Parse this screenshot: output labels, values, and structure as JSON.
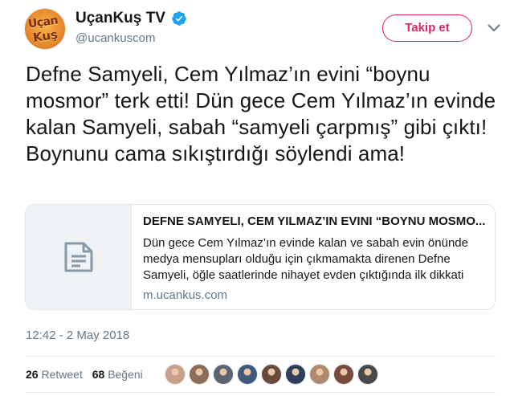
{
  "header": {
    "display_name": "UçanKuş TV",
    "handle": "@ucankuscom",
    "avatar_text_top": "Uçan",
    "avatar_text_bottom": "Kuş",
    "follow_label": "Takip et"
  },
  "tweet": {
    "text": "Defne Samyeli, Cem Yılmaz’ın evini “boynu mosmor” terk etti! Dün gece Cem Yılmaz’ın evinde kalan Samyeli, sabah “samyeli çarpmış” gibi çıktı! Boynunu cama sıkıştırdığı söylendi ama!",
    "timestamp": "12:42 - 2 May 2018"
  },
  "card": {
    "title": "DEFNE SAMYELI, CEM YILMAZ’IN EVINI “BOYNU MOSMO...",
    "description": "Dün gece Cem Yılmaz’ın evinde kalan ve sabah evin önünde medya mensupları olduğu için çıkmamakta direnen Defne Samyeli, öğle saatlerinde nihayet evden çıktığında ilk dikkati çe...",
    "domain": "m.ucankus.com",
    "icon": "document-icon"
  },
  "stats": {
    "retweets_count": "26",
    "retweets_label": "Retweet",
    "likes_count": "68",
    "likes_label": "Beğeni"
  },
  "likers": [
    {
      "name": "liker-avatar-1",
      "color": "#c9a08a"
    },
    {
      "name": "liker-avatar-2",
      "color": "#8a6e5a"
    },
    {
      "name": "liker-avatar-3",
      "color": "#5b6470"
    },
    {
      "name": "liker-avatar-4",
      "color": "#3f5a7a"
    },
    {
      "name": "liker-avatar-5",
      "color": "#6a4a3a"
    },
    {
      "name": "liker-avatar-6",
      "color": "#2e3e5c"
    },
    {
      "name": "liker-avatar-7",
      "color": "#b08a6a"
    },
    {
      "name": "liker-avatar-8",
      "color": "#7a4a3e"
    },
    {
      "name": "liker-avatar-9",
      "color": "#4a4a4a"
    }
  ],
  "colors": {
    "accent": "#e0245e",
    "verified": "#1da1f2",
    "muted": "#657786"
  }
}
